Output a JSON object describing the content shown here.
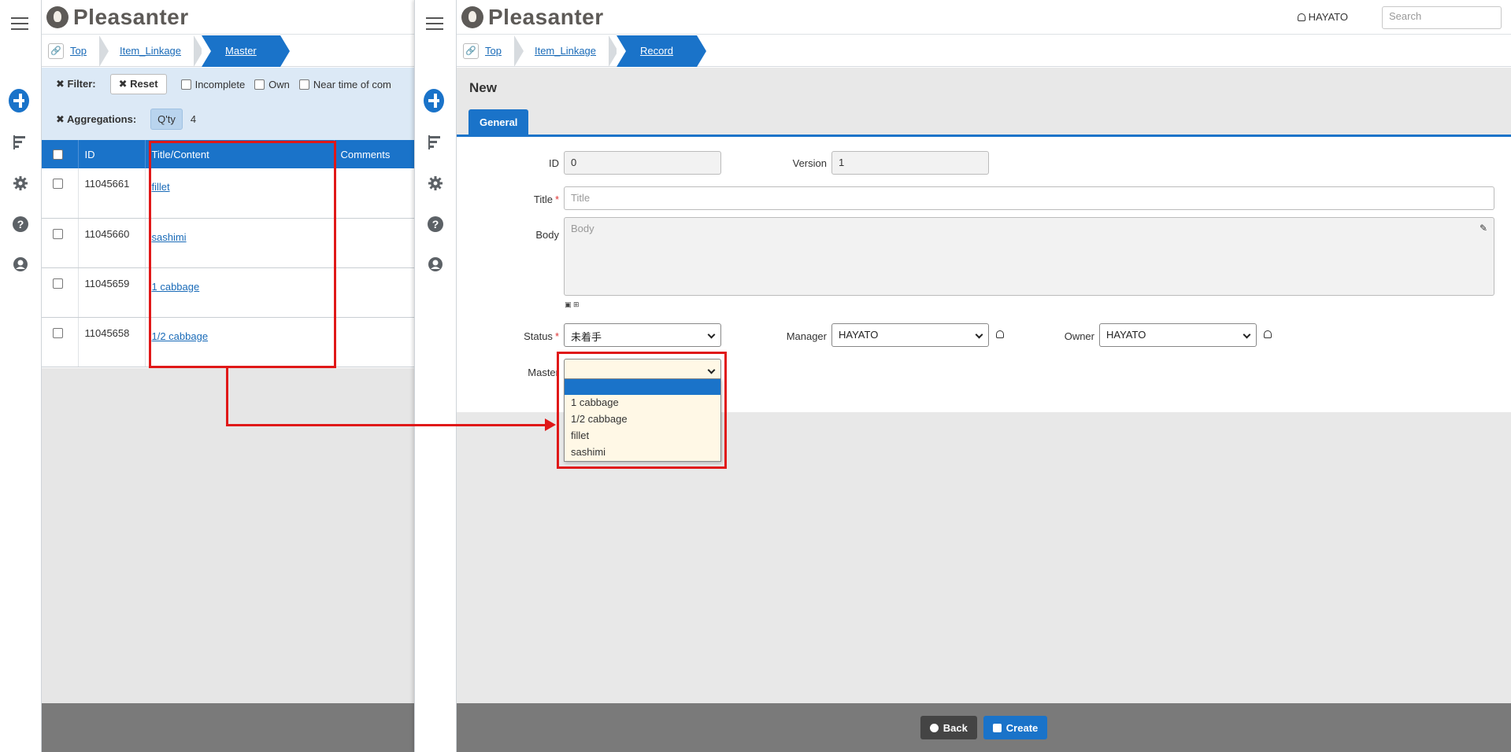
{
  "app": {
    "name": "Pleasanter"
  },
  "list_window": {
    "breadcrumb": [
      "Top",
      "Item_Linkage",
      "Master"
    ],
    "filter": {
      "label": "Filter:",
      "reset": "Reset",
      "options": [
        "Incomplete",
        "Own",
        "Near time of com"
      ]
    },
    "aggregation": {
      "label": "Aggregations:",
      "qty_label": "Q'ty",
      "qty_value": "4"
    },
    "table": {
      "columns": [
        "ID",
        "Title/Content",
        "Comments"
      ],
      "rows": [
        {
          "id": "11045661",
          "title": "fillet"
        },
        {
          "id": "11045660",
          "title": "sashimi"
        },
        {
          "id": "11045659",
          "title": "1 cabbage"
        },
        {
          "id": "11045658",
          "title": "1/2 cabbage"
        }
      ]
    }
  },
  "record_window": {
    "breadcrumb": [
      "Top",
      "Item_Linkage",
      "Record"
    ],
    "user": "HAYATO",
    "search_placeholder": "Search",
    "page_title": "New",
    "tab": "General",
    "fields": {
      "id_label": "ID",
      "id_value": "0",
      "version_label": "Version",
      "version_value": "1",
      "title_label": "Title",
      "title_placeholder": "Title",
      "body_label": "Body",
      "body_placeholder": "Body",
      "status_label": "Status",
      "status_value": "未着手",
      "manager_label": "Manager",
      "manager_value": "HAYATO",
      "owner_label": "Owner",
      "owner_value": "HAYATO",
      "master_label": "Master",
      "master_value": ""
    },
    "master_options": [
      "",
      "1 cabbage",
      "1/2 cabbage",
      "fillet",
      "sashimi"
    ],
    "buttons": {
      "back": "Back",
      "create": "Create"
    }
  },
  "colors": {
    "accent": "#1a73c9",
    "annotation": "#e01818",
    "filter_bg": "#dce9f6"
  },
  "icons": [
    "hamburger-icon",
    "plus-circle-icon",
    "gantt-icon",
    "gear-icon",
    "help-icon",
    "user-icon",
    "link-icon",
    "pencil-icon",
    "person-icon"
  ]
}
